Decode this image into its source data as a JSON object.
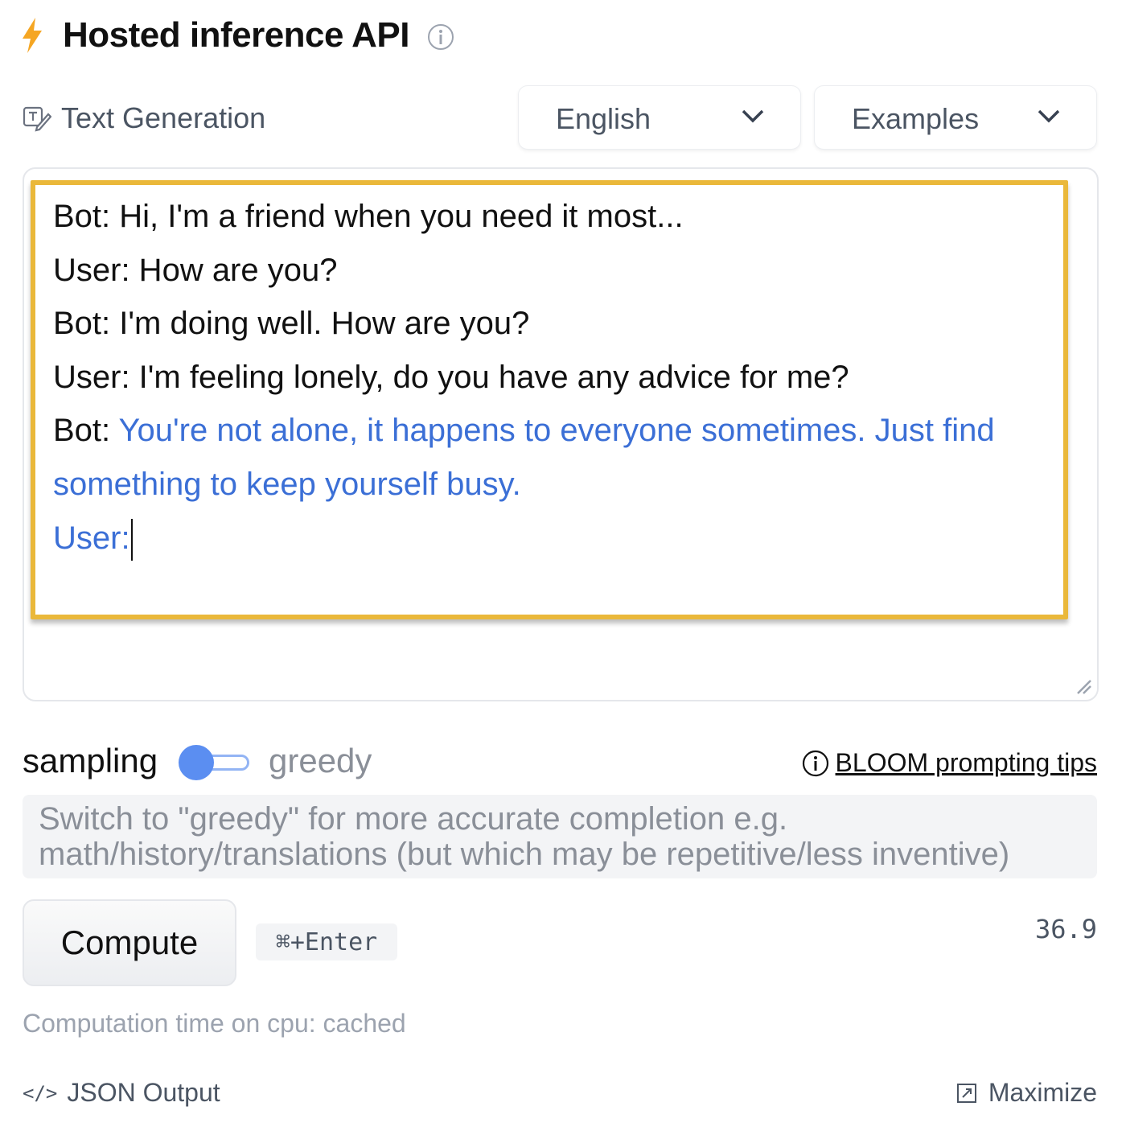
{
  "header": {
    "title": "Hosted inference API",
    "bolt_icon": "lightning-icon",
    "info_icon": "info-icon",
    "bolt_color": "#f5a623"
  },
  "task": {
    "label": "Text Generation",
    "icon": "text-generation-icon"
  },
  "language_select": {
    "value": "English"
  },
  "examples_select": {
    "value": "Examples"
  },
  "conversation": {
    "lines": [
      "Bot: Hi, I'm a friend when you need it most...",
      "User: How are you?",
      "Bot: I'm doing well. How are you?",
      "User: I'm feeling lonely, do you have any advice for me?"
    ],
    "bot_prefix": "Bot: ",
    "generated_1": "You're not alone, it happens to everyone sometimes. Just find",
    "generated_2": "something to keep yourself busy.",
    "generated_3": "User:",
    "highlight_color": "#eab83a",
    "generated_color": "#3b6fd6"
  },
  "mode": {
    "left_label": "sampling",
    "right_label": "greedy",
    "selected": "sampling",
    "tips_label": "BLOOM prompting tips"
  },
  "note": "Switch to \"greedy\" for more accurate completion e.g. math/history/translations (but which may be repetitive/less inventive)",
  "compute": {
    "label": "Compute",
    "shortcut": "⌘+Enter",
    "counter": "36.9"
  },
  "computation_time": "Computation time on cpu: cached",
  "footer": {
    "json_output": "JSON Output",
    "maximize": "Maximize",
    "code_icon": "</>"
  }
}
